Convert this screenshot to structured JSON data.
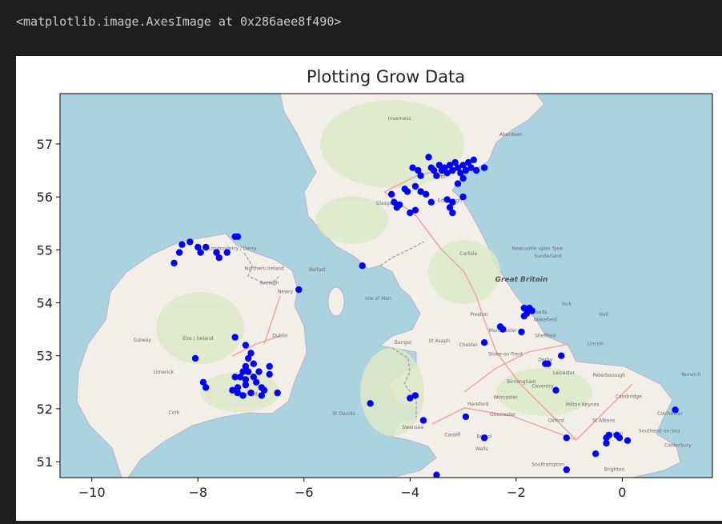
{
  "output_text": "<matplotlib.image.AxesImage at 0x286aee8f490>",
  "chart_data": {
    "type": "scatter",
    "title": "Plotting Grow Data",
    "xlabel": "",
    "ylabel": "",
    "xlim": [
      -10.6,
      1.7
    ],
    "ylim": [
      50.7,
      57.95
    ],
    "xticks": [
      "−10",
      "−8",
      "−6",
      "−4",
      "−2",
      "0"
    ],
    "xtick_values": [
      -10,
      -8,
      -6,
      -4,
      -2,
      0
    ],
    "yticks": [
      "51",
      "52",
      "53",
      "54",
      "55",
      "56",
      "57"
    ],
    "ytick_values": [
      51,
      52,
      53,
      54,
      55,
      56,
      57
    ],
    "marker_color": "#0000ff",
    "background": "OpenStreetMap basemap of Great Britain and Ireland",
    "map_labels": [
      {
        "text": "Great Britain",
        "lon": -1.9,
        "lat": 54.4
      },
      {
        "text": "Éire / Ireland",
        "lon": -8.0,
        "lat": 53.3
      },
      {
        "text": "Isle of Man",
        "lon": -4.6,
        "lat": 54.05
      },
      {
        "text": "Belfast",
        "lon": -5.75,
        "lat": 54.6
      },
      {
        "text": "Dublin",
        "lon": -6.45,
        "lat": 53.35
      },
      {
        "text": "Glasgow",
        "lon": -4.45,
        "lat": 55.85
      },
      {
        "text": "Edinburgh",
        "lon": -3.25,
        "lat": 55.9
      },
      {
        "text": "Perth",
        "lon": -3.45,
        "lat": 56.35
      },
      {
        "text": "Inverness",
        "lon": -4.2,
        "lat": 57.45
      },
      {
        "text": "Aberdeen",
        "lon": -2.1,
        "lat": 57.15
      },
      {
        "text": "Newcastle upon Tyne",
        "lon": -1.6,
        "lat": 55.0
      },
      {
        "text": "Carlisle",
        "lon": -2.9,
        "lat": 54.9
      },
      {
        "text": "Sunderland",
        "lon": -1.4,
        "lat": 54.85
      },
      {
        "text": "Leeds",
        "lon": -1.55,
        "lat": 53.8
      },
      {
        "text": "York",
        "lon": -1.05,
        "lat": 53.95
      },
      {
        "text": "Preston",
        "lon": -2.7,
        "lat": 53.75
      },
      {
        "text": "Manchester",
        "lon": -2.25,
        "lat": 53.45
      },
      {
        "text": "Sheffield",
        "lon": -1.45,
        "lat": 53.35
      },
      {
        "text": "Wakefield",
        "lon": -1.45,
        "lat": 53.65
      },
      {
        "text": "Hull",
        "lon": -0.35,
        "lat": 53.75
      },
      {
        "text": "Lincoln",
        "lon": -0.5,
        "lat": 53.2
      },
      {
        "text": "Chester",
        "lon": -2.9,
        "lat": 53.18
      },
      {
        "text": "Stoke-on-Trent",
        "lon": -2.2,
        "lat": 53.0
      },
      {
        "text": "Derby",
        "lon": -1.45,
        "lat": 52.9
      },
      {
        "text": "Leicester",
        "lon": -1.1,
        "lat": 52.65
      },
      {
        "text": "Birmingham",
        "lon": -1.9,
        "lat": 52.48
      },
      {
        "text": "Coventry",
        "lon": -1.5,
        "lat": 52.4
      },
      {
        "text": "Peterborough",
        "lon": -0.25,
        "lat": 52.6
      },
      {
        "text": "Norwich",
        "lon": 1.3,
        "lat": 52.62
      },
      {
        "text": "Cambridge",
        "lon": 0.12,
        "lat": 52.2
      },
      {
        "text": "Milton Keynes",
        "lon": -0.75,
        "lat": 52.05
      },
      {
        "text": "Oxford",
        "lon": -1.25,
        "lat": 51.75
      },
      {
        "text": "St Albans",
        "lon": -0.35,
        "lat": 51.75
      },
      {
        "text": "Colchester",
        "lon": 0.9,
        "lat": 51.88
      },
      {
        "text": "Southend-on-Sea",
        "lon": 0.7,
        "lat": 51.55
      },
      {
        "text": "London",
        "lon": -0.15,
        "lat": 51.5
      },
      {
        "text": "Canterbury",
        "lon": 1.05,
        "lat": 51.28
      },
      {
        "text": "Brighton",
        "lon": -0.15,
        "lat": 50.83
      },
      {
        "text": "Southampton",
        "lon": -1.4,
        "lat": 50.92
      },
      {
        "text": "Bristol",
        "lon": -2.6,
        "lat": 51.45
      },
      {
        "text": "Cardiff",
        "lon": -3.2,
        "lat": 51.48
      },
      {
        "text": "Swansea",
        "lon": -3.95,
        "lat": 51.62
      },
      {
        "text": "Gloucester",
        "lon": -2.25,
        "lat": 51.86
      },
      {
        "text": "Hereford",
        "lon": -2.72,
        "lat": 52.06
      },
      {
        "text": "Worcester",
        "lon": -2.2,
        "lat": 52.19
      },
      {
        "text": "Wells",
        "lon": -2.65,
        "lat": 51.21
      },
      {
        "text": "St Davids",
        "lon": -5.25,
        "lat": 51.88
      },
      {
        "text": "Bangor",
        "lon": -4.13,
        "lat": 53.22
      },
      {
        "text": "St Asaph",
        "lon": -3.45,
        "lat": 53.25
      },
      {
        "text": "Galway",
        "lon": -9.05,
        "lat": 53.27
      },
      {
        "text": "Limerick",
        "lon": -8.65,
        "lat": 52.66
      },
      {
        "text": "Cork",
        "lon": -8.45,
        "lat": 51.9
      },
      {
        "text": "Waterford",
        "lon": -7.1,
        "lat": 52.25
      },
      {
        "text": "Armagh",
        "lon": -6.65,
        "lat": 54.35
      },
      {
        "text": "Newry",
        "lon": -6.35,
        "lat": 54.18
      },
      {
        "text": "Londonderry / Derry",
        "lon": -7.35,
        "lat": 55.0
      },
      {
        "text": "Northern Ireland",
        "lon": -6.75,
        "lat": 54.62
      }
    ],
    "points": [
      [
        -3.65,
        56.75
      ],
      [
        -3.6,
        56.55
      ],
      [
        -3.55,
        56.5
      ],
      [
        -3.45,
        56.6
      ],
      [
        -3.35,
        56.55
      ],
      [
        -3.25,
        56.6
      ],
      [
        -3.2,
        56.5
      ],
      [
        -3.15,
        56.65
      ],
      [
        -3.1,
        56.55
      ],
      [
        -3.05,
        56.45
      ],
      [
        -3.0,
        56.6
      ],
      [
        -2.95,
        56.5
      ],
      [
        -2.9,
        56.65
      ],
      [
        -2.85,
        56.55
      ],
      [
        -2.8,
        56.7
      ],
      [
        -2.75,
        56.5
      ],
      [
        -2.6,
        56.55
      ],
      [
        -3.85,
        56.5
      ],
      [
        -3.8,
        56.4
      ],
      [
        -3.95,
        56.55
      ],
      [
        -3.4,
        56.5
      ],
      [
        -3.3,
        56.45
      ],
      [
        -3.5,
        56.4
      ],
      [
        -3.0,
        56.35
      ],
      [
        -3.1,
        56.25
      ],
      [
        -4.1,
        56.15
      ],
      [
        -4.05,
        56.1
      ],
      [
        -3.9,
        56.2
      ],
      [
        -3.8,
        56.1
      ],
      [
        -3.7,
        56.05
      ],
      [
        -4.35,
        56.05
      ],
      [
        -4.3,
        55.9
      ],
      [
        -4.2,
        55.85
      ],
      [
        -4.25,
        55.8
      ],
      [
        -4.0,
        55.7
      ],
      [
        -3.9,
        55.75
      ],
      [
        -3.6,
        55.9
      ],
      [
        -3.3,
        55.95
      ],
      [
        -3.2,
        55.9
      ],
      [
        -3.25,
        55.8
      ],
      [
        -3.2,
        55.7
      ],
      [
        -3.0,
        56.0
      ],
      [
        -4.9,
        54.7
      ],
      [
        -8.45,
        54.75
      ],
      [
        -8.35,
        54.95
      ],
      [
        -8.3,
        55.1
      ],
      [
        -8.15,
        55.15
      ],
      [
        -8.0,
        55.05
      ],
      [
        -7.95,
        54.95
      ],
      [
        -7.85,
        55.05
      ],
      [
        -7.65,
        54.95
      ],
      [
        -7.6,
        54.85
      ],
      [
        -7.45,
        54.95
      ],
      [
        -7.3,
        55.25
      ],
      [
        -7.25,
        55.25
      ],
      [
        -6.1,
        54.25
      ],
      [
        -7.3,
        53.35
      ],
      [
        -8.05,
        52.95
      ],
      [
        -7.9,
        52.5
      ],
      [
        -7.85,
        52.4
      ],
      [
        -7.3,
        52.6
      ],
      [
        -7.25,
        52.4
      ],
      [
        -7.2,
        52.6
      ],
      [
        -7.15,
        52.7
      ],
      [
        -7.1,
        52.55
      ],
      [
        -7.1,
        52.8
      ],
      [
        -7.05,
        52.95
      ],
      [
        -7.0,
        53.05
      ],
      [
        -7.05,
        52.7
      ],
      [
        -6.95,
        52.6
      ],
      [
        -6.95,
        52.85
      ],
      [
        -6.85,
        52.7
      ],
      [
        -6.9,
        52.5
      ],
      [
        -6.8,
        52.4
      ],
      [
        -6.75,
        52.35
      ],
      [
        -6.8,
        52.25
      ],
      [
        -6.65,
        52.8
      ],
      [
        -6.65,
        52.65
      ],
      [
        -6.5,
        52.3
      ],
      [
        -7.1,
        53.2
      ],
      [
        -7.0,
        52.3
      ],
      [
        -7.15,
        52.25
      ],
      [
        -7.25,
        52.3
      ],
      [
        -7.35,
        52.35
      ],
      [
        -7.1,
        52.45
      ],
      [
        -1.85,
        53.9
      ],
      [
        -1.8,
        53.8
      ],
      [
        -1.75,
        53.9
      ],
      [
        -1.7,
        53.85
      ],
      [
        -1.85,
        53.75
      ],
      [
        -2.3,
        53.55
      ],
      [
        -2.25,
        53.5
      ],
      [
        -1.9,
        53.45
      ],
      [
        -2.6,
        53.25
      ],
      [
        -1.45,
        52.85
      ],
      [
        -1.4,
        52.85
      ],
      [
        -1.15,
        53.0
      ],
      [
        -1.25,
        52.35
      ],
      [
        -1.05,
        51.45
      ],
      [
        -3.9,
        52.25
      ],
      [
        -4.0,
        52.2
      ],
      [
        -4.75,
        52.1
      ],
      [
        -3.75,
        51.78
      ],
      [
        -2.95,
        51.85
      ],
      [
        -2.6,
        51.45
      ],
      [
        -3.5,
        50.75
      ],
      [
        -0.5,
        51.15
      ],
      [
        -0.3,
        51.45
      ],
      [
        -0.3,
        51.35
      ],
      [
        -0.25,
        51.5
      ],
      [
        -0.1,
        51.5
      ],
      [
        -0.05,
        51.45
      ],
      [
        0.1,
        51.4
      ],
      [
        1.0,
        51.98
      ],
      [
        -1.05,
        50.85
      ]
    ]
  }
}
